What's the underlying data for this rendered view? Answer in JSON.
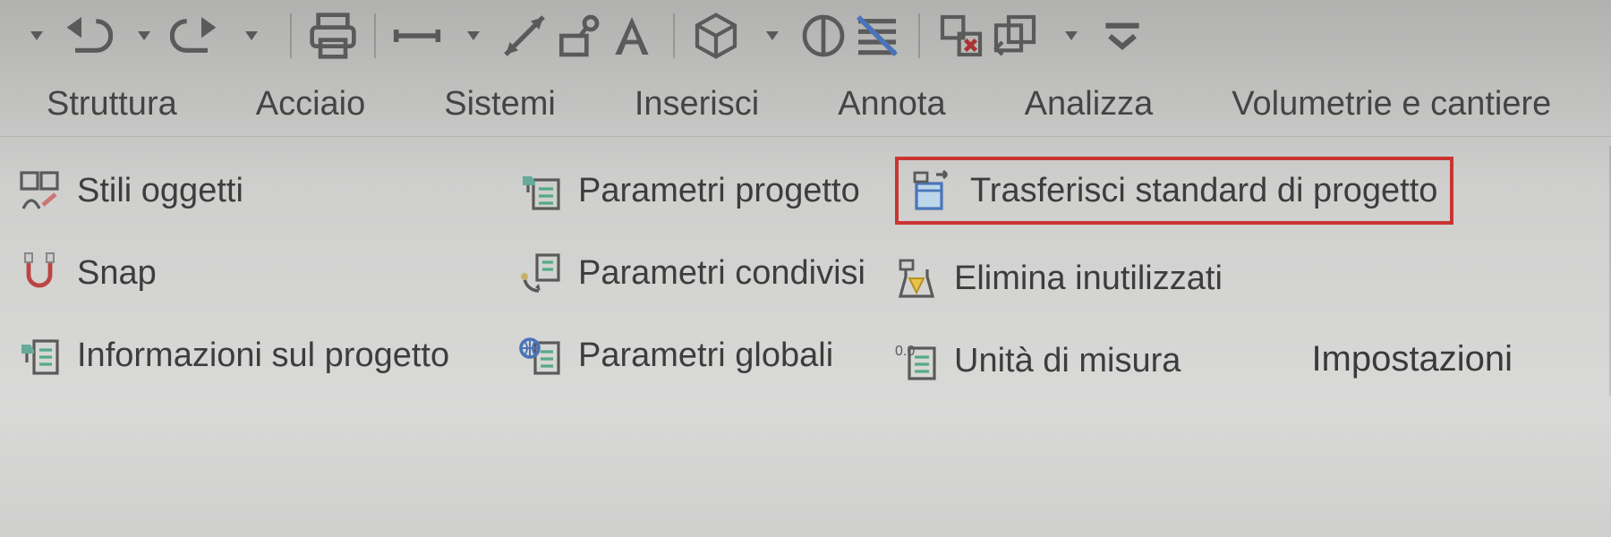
{
  "tabs": {
    "struttura": "Struttura",
    "acciaio": "Acciaio",
    "sistemi": "Sistemi",
    "inserisci": "Inserisci",
    "annota": "Annota",
    "analizza": "Analizza",
    "volumetrie": "Volumetrie e cantiere"
  },
  "commands": {
    "stili_oggetti": "Stili oggetti",
    "snap": "Snap",
    "informazioni_progetto": "Informazioni sul progetto",
    "parametri_progetto": "Parametri progetto",
    "parametri_condivisi": "Parametri condivisi",
    "parametri_globali": "Parametri  globali",
    "trasferisci_standard": "Trasferisci standard di progetto",
    "elimina_inutilizzati": "Elimina inutilizzati",
    "unita_misura": "Unità di misura"
  },
  "panel_title": "Impostazioni"
}
